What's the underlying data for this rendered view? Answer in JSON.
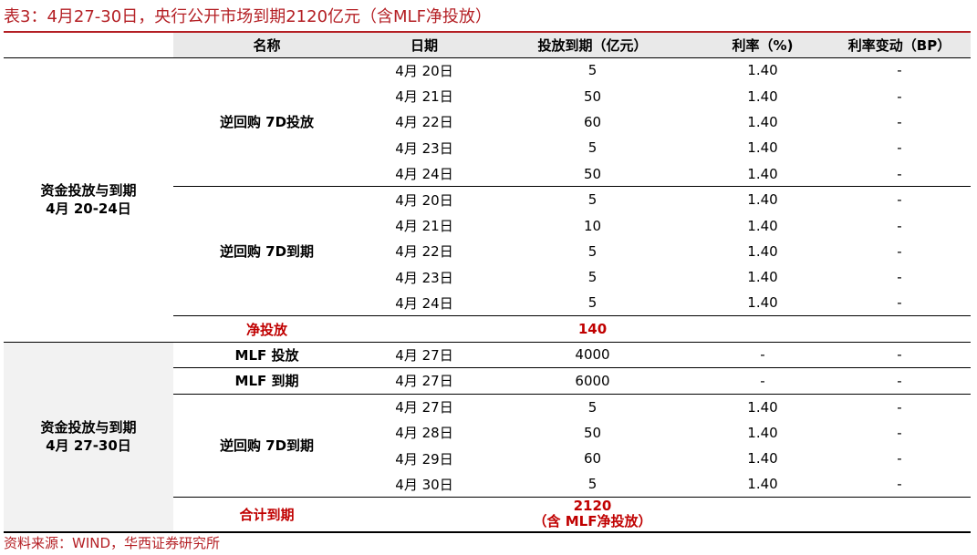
{
  "title": "表3：4月27-30日，央行公开市场到期2120亿元（含MLF净投放）",
  "source": "资料来源：WIND，华西证券研究所",
  "headers": [
    "名称",
    "日期",
    "投放到期（亿元）",
    "利率（%)",
    "利率变动（BP）"
  ],
  "group1": {
    "label_line1": "资金投放与到期",
    "label_line2": "4月  20-24日",
    "sub1": {
      "name": "逆回购 7D投放",
      "rows": [
        {
          "date": "4月 20日",
          "amount": "5",
          "rate": "1.40",
          "change": "-"
        },
        {
          "date": "4月 21日",
          "amount": "50",
          "rate": "1.40",
          "change": "-"
        },
        {
          "date": "4月 22日",
          "amount": "60",
          "rate": "1.40",
          "change": "-"
        },
        {
          "date": "4月 23日",
          "amount": "5",
          "rate": "1.40",
          "change": "-"
        },
        {
          "date": "4月 24日",
          "amount": "50",
          "rate": "1.40",
          "change": "-"
        }
      ]
    },
    "sub2": {
      "name": "逆回购 7D到期",
      "rows": [
        {
          "date": "4月 20日",
          "amount": "5",
          "rate": "1.40",
          "change": "-"
        },
        {
          "date": "4月 21日",
          "amount": "10",
          "rate": "1.40",
          "change": "-"
        },
        {
          "date": "4月 22日",
          "amount": "5",
          "rate": "1.40",
          "change": "-"
        },
        {
          "date": "4月 23日",
          "amount": "5",
          "rate": "1.40",
          "change": "-"
        },
        {
          "date": "4月 24日",
          "amount": "5",
          "rate": "1.40",
          "change": "-"
        }
      ]
    },
    "net_label": "净投放",
    "net_value": "140"
  },
  "group2": {
    "label_line1": "资金投放与到期",
    "label_line2": "4月  27-30日",
    "mlf_in": {
      "name": "MLF 投放",
      "date": "4月 27日",
      "amount": "4000",
      "rate": "-",
      "change": "-"
    },
    "mlf_out": {
      "name": "MLF 到期",
      "date": "4月 27日",
      "amount": "6000",
      "rate": "-",
      "change": "-"
    },
    "sub3": {
      "name": "逆回购 7D到期",
      "rows": [
        {
          "date": "4月 27日",
          "amount": "5",
          "rate": "1.40",
          "change": "-"
        },
        {
          "date": "4月 28日",
          "amount": "50",
          "rate": "1.40",
          "change": "-"
        },
        {
          "date": "4月 29日",
          "amount": "60",
          "rate": "1.40",
          "change": "-"
        },
        {
          "date": "4月 30日",
          "amount": "5",
          "rate": "1.40",
          "change": "-"
        }
      ]
    },
    "total_label": "合计到期",
    "total_value": "2120",
    "total_note": "（含 MLF净投放）"
  }
}
